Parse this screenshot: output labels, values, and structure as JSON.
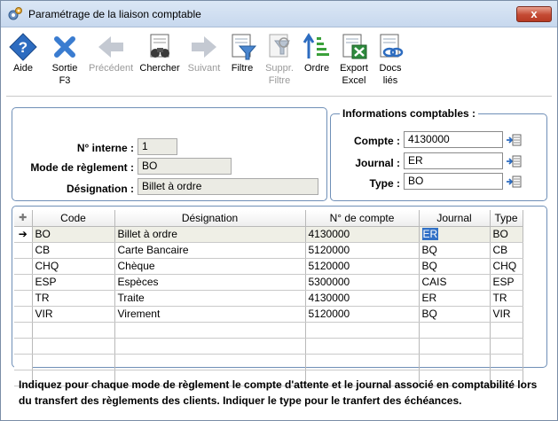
{
  "window": {
    "title": "Paramétrage de la liaison comptable",
    "close_label": "x"
  },
  "toolbar": {
    "aide": "Aide",
    "sortie_l1": "Sortie",
    "sortie_l2": "F3",
    "precedent": "Précédent",
    "chercher": "Chercher",
    "suivant": "Suivant",
    "filtre": "Filtre",
    "suppr_l1": "Suppr.",
    "suppr_l2": "Filtre",
    "ordre": "Ordre",
    "export_l1": "Export",
    "export_l2": "Excel",
    "docs_l1": "Docs",
    "docs_l2": "liés"
  },
  "form": {
    "num_interne_label": "N° interne :",
    "num_interne_value": "1",
    "mode_label": "Mode de règlement :",
    "mode_value": "BO",
    "designation_label": "Désignation :",
    "designation_value": "Billet à ordre"
  },
  "compta": {
    "group_title": "Informations comptables :",
    "compte_label": "Compte :",
    "compte_value": "4130000",
    "journal_label": "Journal :",
    "journal_value": "ER",
    "type_label": "Type :",
    "type_value": "BO"
  },
  "grid": {
    "columns": [
      "Code",
      "Désignation",
      "N° de compte",
      "Journal",
      "Type"
    ],
    "rows": [
      {
        "code": "BO",
        "designation": "Billet à ordre",
        "compte": "4130000",
        "journal": "ER",
        "type": "BO"
      },
      {
        "code": "CB",
        "designation": "Carte Bancaire",
        "compte": "5120000",
        "journal": "BQ",
        "type": "CB"
      },
      {
        "code": "CHQ",
        "designation": "Chèque",
        "compte": "5120000",
        "journal": "BQ",
        "type": "CHQ"
      },
      {
        "code": "ESP",
        "designation": "Espèces",
        "compte": "5300000",
        "journal": "CAIS",
        "type": "ESP"
      },
      {
        "code": "TR",
        "designation": "Traite",
        "compte": "4130000",
        "journal": "ER",
        "type": "TR"
      },
      {
        "code": "VIR",
        "designation": "Virement",
        "compte": "5120000",
        "journal": "BQ",
        "type": "VIR"
      }
    ]
  },
  "hint": {
    "line1": "Indiquez pour chaque mode de règlement le compte d'attente et le journal associé en comptabilité lors",
    "line2": "du transfert des règlements des clients. Indiquer le type pour le tranfert des échéances."
  },
  "colors": {
    "accent": "#3271c6",
    "panel_border": "#6f8fb7",
    "readonly_bg": "#ebebe4"
  }
}
